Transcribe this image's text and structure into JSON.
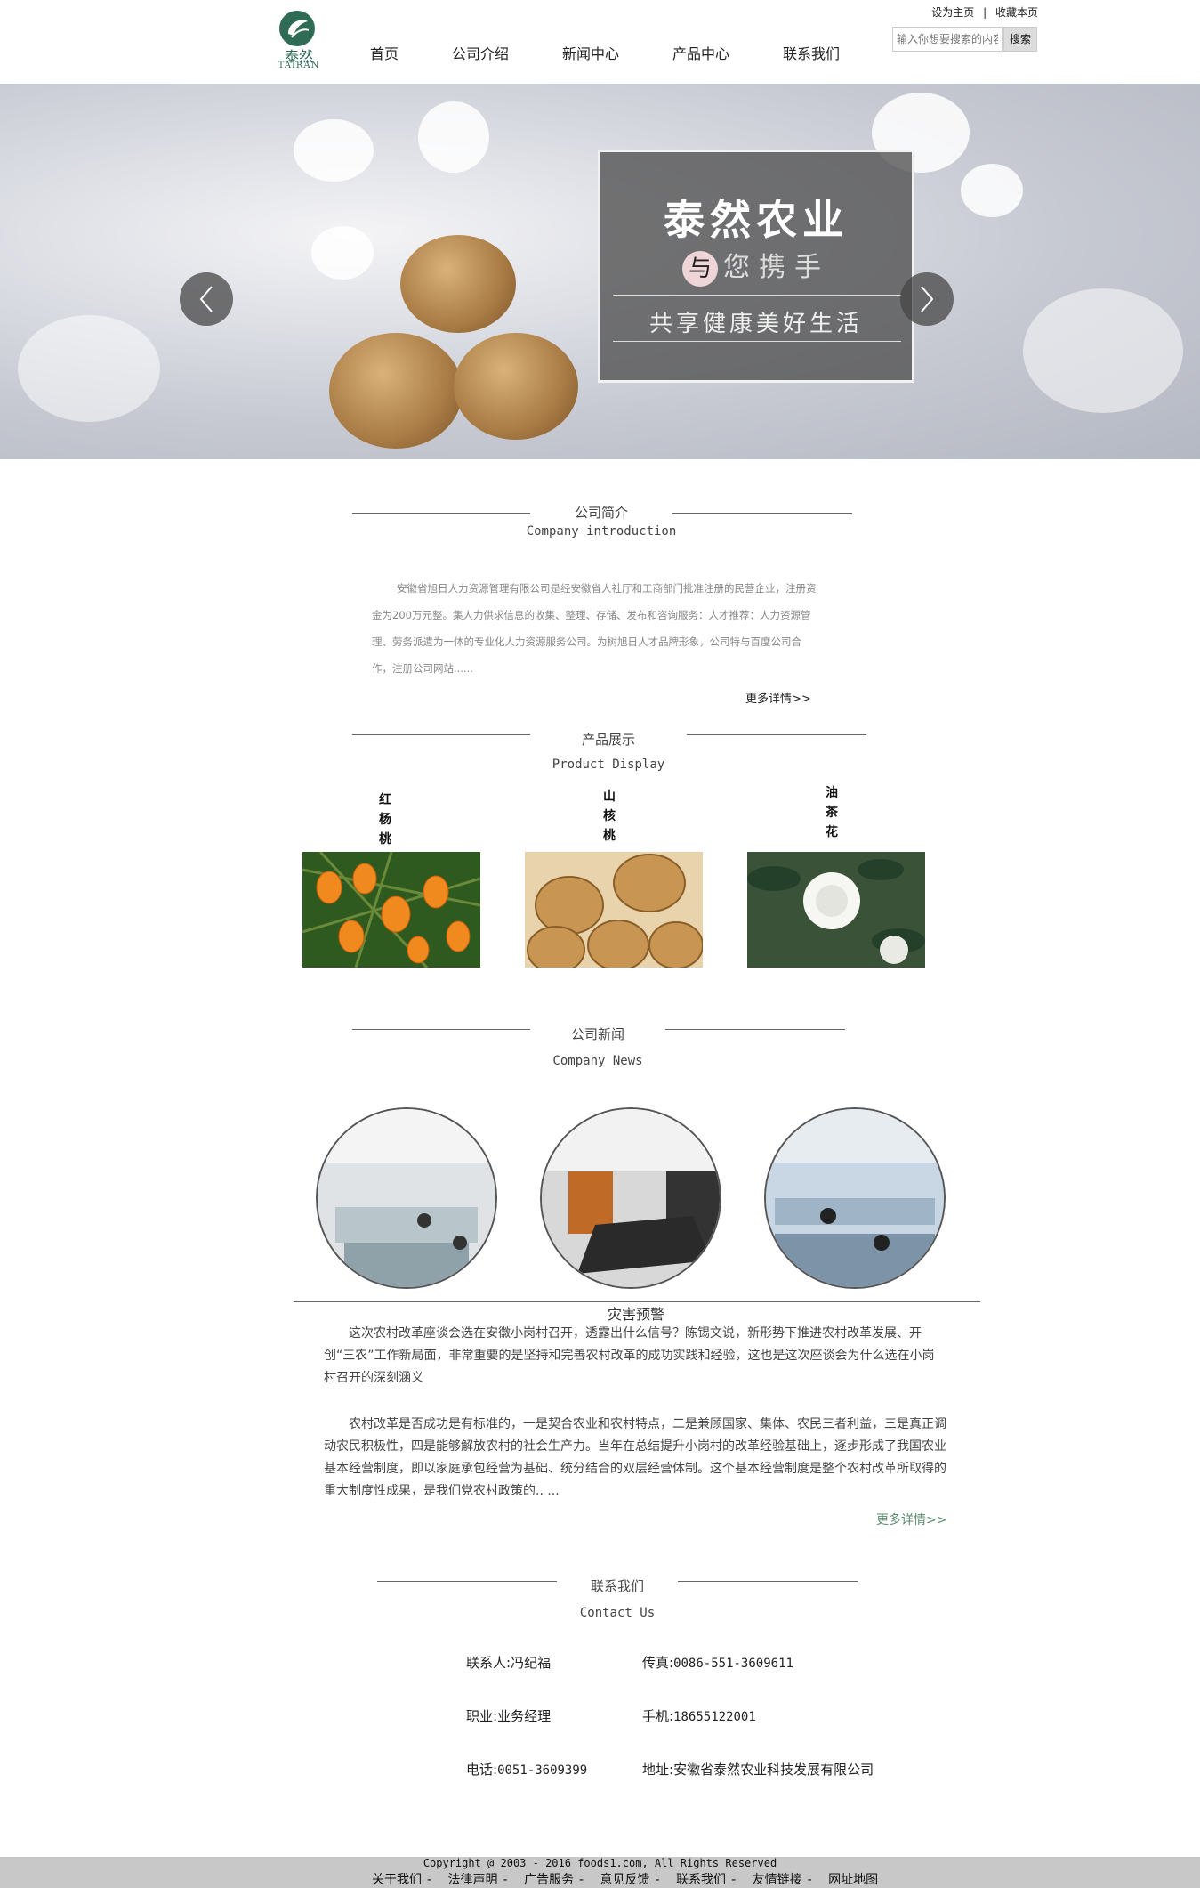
{
  "logo": {
    "cn": "泰然",
    "en": "TAIRAN"
  },
  "nav": [
    "首页",
    "公司介绍",
    "新闻中心",
    "产品中心",
    "联系我们"
  ],
  "toplinks": {
    "home": "设为主页",
    "sep": "|",
    "fav": "收藏本页"
  },
  "search": {
    "placeholder": "输入你想要搜索的内容",
    "button": "搜索"
  },
  "banner": {
    "title": "泰然农业",
    "badge": "与",
    "line2": "您携手",
    "line3": "共享健康美好生活"
  },
  "intro": {
    "title_cn": "公司简介",
    "title_en": "Company introduction",
    "text": "安徽省旭日人力资源管理有限公司是经安徽省人社厅和工商部门批准注册的民营企业，注册资金为200万元整。集人力供求信息的收集、整理、存储、发布和咨询服务：人才推荐：人力资源管理、劳务派遣为一体的专业化人力资源服务公司。为树旭日人才品牌形象，公司特与百度公司合作，注册公司网站......",
    "more": "更多详情>>"
  },
  "products": {
    "title_cn": "产品展示",
    "title_en": "Product Display",
    "items": [
      {
        "label": [
          "红",
          "杨",
          "桃"
        ]
      },
      {
        "label": [
          "山",
          "核",
          "桃"
        ]
      },
      {
        "label": [
          "油",
          "茶",
          "花"
        ]
      }
    ]
  },
  "news": {
    "title_cn": "公司新闻",
    "title_en": "Company News",
    "headline": "灾害预警",
    "para1": "这次农村改革座谈会选在安徽小岗村召开，透露出什么信号？陈锡文说，新形势下推进农村改革发展、开创“三农”工作新局面，非常重要的是坚持和完善农村改革的成功实践和经验，这也是这次座谈会为什么选在小岗村召开的深刻涵义",
    "para2": "农村改革是否成功是有标准的，一是契合农业和农村特点，二是兼顾国家、集体、农民三者利益，三是真正调动农民积极性，四是能够解放农村的社会生产力。当年在总结提升小岗村的改革经验基础上，逐步形成了我国农业基本经营制度，即以家庭承包经营为基础、统分结合的双层经营体制。这个基本经营制度是整个农村改革所取得的重大制度性成果，是我们党农村政策的.. ...",
    "more": "更多详情>>"
  },
  "contact": {
    "title_cn": "联系我们",
    "title_en": "Contact Us",
    "person_label": "联系人:",
    "person": "冯纪福",
    "fax_label": "传真:",
    "fax": "0086-551-3609611",
    "job_label": "职业:",
    "job": "业务经理",
    "mobile_label": "手机:",
    "mobile": "18655122001",
    "phone_label": "电话:",
    "phone": "0051-3609399",
    "addr_label": "地址:",
    "addr": "安徽省泰然农业科技发展有限公司"
  },
  "footer": {
    "copyright": "Copyright @ 2003 - 2016 foods1.com, All Rights Reserved",
    "links": [
      "关于我们",
      "法律声明",
      "广告服务",
      "意见反馈",
      "联系我们",
      "友情链接",
      "网址地图"
    ]
  },
  "colors": {
    "brand": "#2f6b55",
    "more_link": "#5a8a6e",
    "footer_bg": "#c8c8c8"
  }
}
